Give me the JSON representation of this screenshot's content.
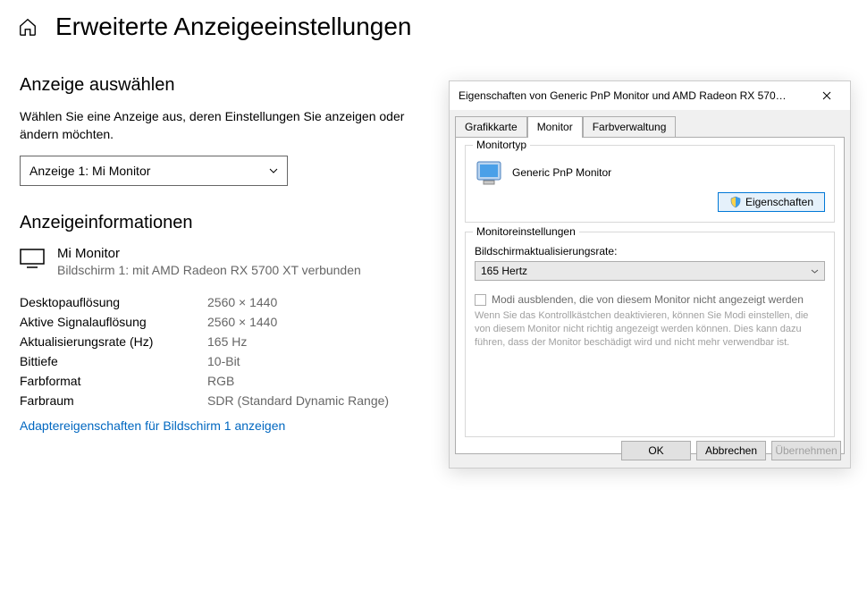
{
  "header": {
    "title": "Erweiterte Anzeigeeinstellungen"
  },
  "select_section": {
    "title": "Anzeige auswählen",
    "instruction": "Wählen Sie eine Anzeige aus, deren Einstellungen Sie anzeigen oder ändern möchten.",
    "selected": "Anzeige 1: Mi Monitor"
  },
  "info_section": {
    "title": "Anzeigeinformationen",
    "monitor_name": "Mi Monitor",
    "monitor_sub": "Bildschirm 1: mit AMD Radeon RX 5700 XT verbunden",
    "rows": [
      {
        "label": "Desktopauflösung",
        "value": "2560 × 1440"
      },
      {
        "label": "Aktive Signalauflösung",
        "value": "2560 × 1440"
      },
      {
        "label": "Aktualisierungsrate (Hz)",
        "value": "165 Hz"
      },
      {
        "label": "Bittiefe",
        "value": "10-Bit"
      },
      {
        "label": "Farbformat",
        "value": "RGB"
      },
      {
        "label": "Farbraum",
        "value": "SDR (Standard Dynamic Range)"
      }
    ],
    "adapter_link": "Adaptereigenschaften für Bildschirm 1 anzeigen"
  },
  "dialog": {
    "title": "Eigenschaften von Generic PnP Monitor und AMD Radeon RX 570…",
    "tabs": {
      "graphics": "Grafikkarte",
      "monitor": "Monitor",
      "color": "Farbverwaltung"
    },
    "monitor_type": {
      "group": "Monitortyp",
      "name": "Generic PnP Monitor",
      "btn": "Eigenschaften"
    },
    "monitor_settings": {
      "group": "Monitoreinstellungen",
      "refresh_label": "Bildschirmaktualisierungsrate:",
      "refresh_value": "165 Hertz",
      "hide_modes": "Modi ausblenden, die von diesem Monitor nicht angezeigt werden",
      "warn": "Wenn Sie das Kontrollkästchen deaktivieren, können Sie Modi einstellen, die von diesem Monitor nicht richtig angezeigt werden können. Dies kann dazu führen, dass der Monitor beschädigt wird und nicht mehr verwendbar ist."
    },
    "buttons": {
      "ok": "OK",
      "cancel": "Abbrechen",
      "apply": "Übernehmen"
    }
  }
}
